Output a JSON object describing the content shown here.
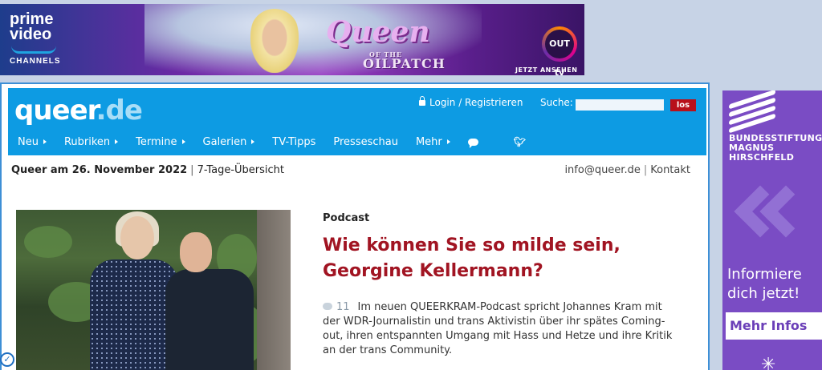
{
  "top_ad": {
    "brand_line1": "prime",
    "brand_line2": "video",
    "brand_line3": "CHANNELS",
    "show_title": "Queen",
    "show_sub_small": "OF THE",
    "show_sub": "OILPATCH",
    "network": "OUT tv",
    "cta": "JETZT ANSEHEN"
  },
  "side_ad": {
    "org": [
      "BUNDESSTIFTUNG",
      "MAGNUS",
      "HIRSCHFELD"
    ],
    "info_line1": "Informiere",
    "info_line2": "dich jetzt!",
    "cta": "Mehr Infos"
  },
  "header": {
    "logo_main": "queer",
    "logo_tld": ".de",
    "login": "Login / Registrieren",
    "search_label": "Suche:",
    "search_value": "",
    "search_button": "los"
  },
  "nav": [
    {
      "label": "Neu",
      "has_arrow": true
    },
    {
      "label": "Rubriken",
      "has_arrow": true
    },
    {
      "label": "Termine",
      "has_arrow": true
    },
    {
      "label": "Galerien",
      "has_arrow": true
    },
    {
      "label": "TV-Tipps",
      "has_arrow": false
    },
    {
      "label": "Presseschau",
      "has_arrow": false
    },
    {
      "label": "Mehr",
      "has_arrow": true
    }
  ],
  "subbar": {
    "date_label": "Queer am 26. November 2022",
    "overview": "7-Tage-Übersicht",
    "email": "info@queer.de",
    "contact": "Kontakt"
  },
  "article": {
    "kicker": "Podcast",
    "headline_line1": "Wie können Sie so milde sein,",
    "headline_line2": "Georgine Kellermann?",
    "comment_count": "11",
    "teaser": "Im neuen QUEERKRAM-Podcast spricht Johannes Kram mit der WDR-Journalistin und trans Aktivistin über ihr spätes Coming-out, ihren entspannten Umgang mit Hass und Hetze und ihre Kritik an der trans Community."
  },
  "colors": {
    "header_blue": "#0d9be3",
    "headline_red": "#a11422",
    "search_button_red": "#b8101a",
    "side_ad_purple": "#7a4cc4"
  }
}
